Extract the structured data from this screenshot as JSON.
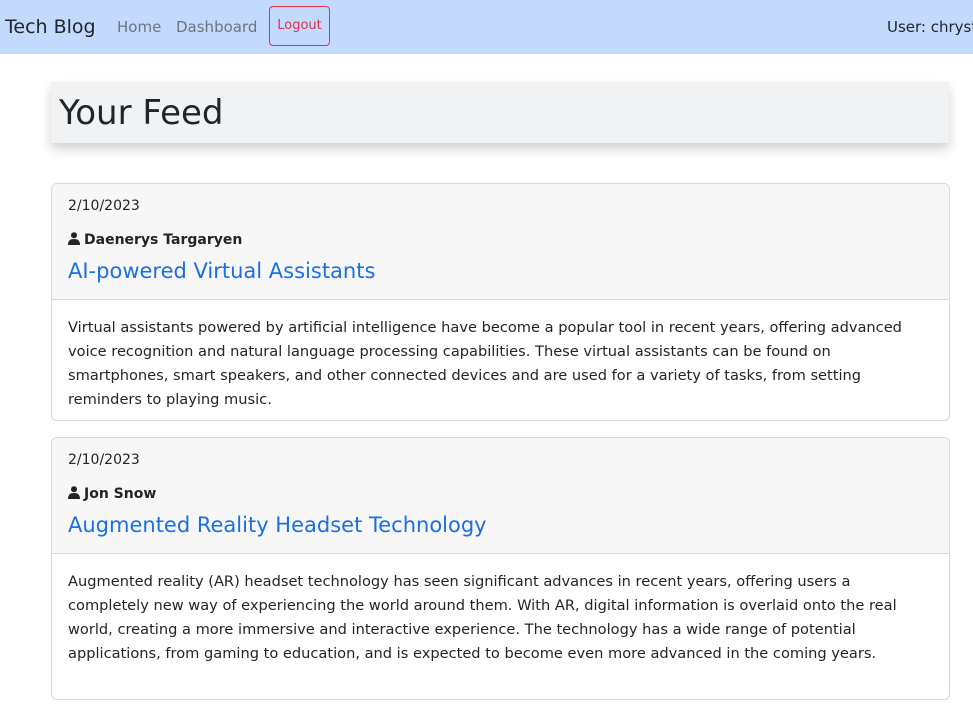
{
  "navbar": {
    "brand": "Tech Blog",
    "links": {
      "home": "Home",
      "dashboard": "Dashboard"
    },
    "logout_label": "Logout",
    "user_text": "User: chrysti"
  },
  "feed": {
    "title": "Your Feed",
    "posts": [
      {
        "date": "2/10/2023",
        "author": "Daenerys Targaryen",
        "title": "AI-powered Virtual Assistants",
        "body": "Virtual assistants powered by artificial intelligence have become a popular tool in recent years, offering advanced voice recognition and natural language processing capabilities. These virtual assistants can be found on smartphones, smart speakers, and other connected devices and are used for a variety of tasks, from setting reminders to playing music."
      },
      {
        "date": "2/10/2023",
        "author": "Jon Snow",
        "title": "Augmented Reality Headset Technology",
        "body": "Augmented reality (AR) headset technology has seen significant advances in recent years, offering users a completely new way of experiencing the world around them. With AR, digital information is overlaid onto the real world, creating a more immersive and interactive experience. The technology has a wide range of potential applications, from gaming to education, and is expected to become even more advanced in the coming years."
      }
    ]
  },
  "icons": {
    "author": "user-icon"
  },
  "colors": {
    "navbar_bg": "#c3dafe",
    "logout": "#dc3545",
    "link": "#1a6fe6"
  }
}
